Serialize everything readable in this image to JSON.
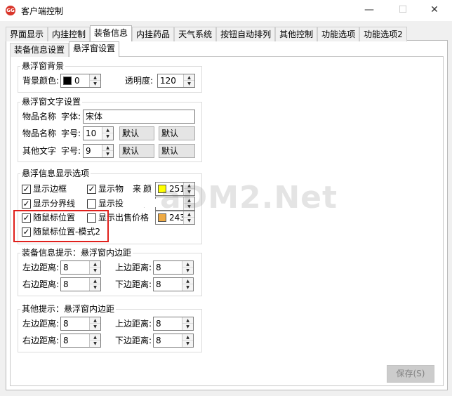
{
  "window": {
    "icon_text": "GG",
    "title": "客户端控制",
    "minimize": "—",
    "maximize": "☐",
    "close": "✕"
  },
  "tabs": [
    "界面显示",
    "内挂控制",
    "装备信息",
    "内挂药品",
    "天气系统",
    "按钮自动排列",
    "其他控制",
    "功能选项",
    "功能选项2"
  ],
  "subtabs": [
    "装备信息设置",
    "悬浮窗设置"
  ],
  "background_group": {
    "title": "悬浮窗背景",
    "color_label": "背景颜色:",
    "color_value": "0",
    "swatch_color": "#000000",
    "opacity_label": "透明度:",
    "opacity_value": "120"
  },
  "text_group": {
    "title": "悬浮窗文字设置",
    "row1_label": "物品名称",
    "font_label": "字体:",
    "font_value": "宋体",
    "row2_label": "物品名称",
    "size_label": "字号:",
    "row2_size": "10",
    "row2_combo1": "默认",
    "row2_combo2": "默认",
    "row3_label": "其他文字",
    "row3_size_label": "字号:",
    "row3_size": "9",
    "row3_combo1": "默认",
    "row3_combo2": "默认"
  },
  "display_group": {
    "title": "悬浮信息显示选项",
    "show_border": "显示边框",
    "show_item": "显示物",
    "show_item_tail": "来",
    "show_item_tail2": "颜",
    "item_color_value": "251",
    "item_color": "#ffff00",
    "show_divider": "显示分界线",
    "show_drop": "显示投",
    "show_drop_tail": "隐",
    "follow_mouse": "随鼠标位置",
    "show_price": "显示出售价格",
    "price_color_value": "243",
    "price_color": "#eeaa44",
    "follow_mouse_mode2": "随鼠标位置-模式2",
    "check_mark": "✓"
  },
  "equip_margin_group": {
    "title": "装备信息提示：悬浮窗内边距",
    "left_label": "左边距离:",
    "left_value": "8",
    "top_label": "上边距离:",
    "top_value": "8",
    "right_label": "右边距离:",
    "right_value": "8",
    "bottom_label": "下边距离:",
    "bottom_value": "8"
  },
  "other_margin_group": {
    "title": "其他提示：悬浮窗内边距",
    "left_label": "左边距离:",
    "left_value": "8",
    "top_label": "上边距离:",
    "top_value": "8",
    "right_label": "右边距离:",
    "right_value": "8",
    "bottom_label": "下边距离:",
    "bottom_value": "8"
  },
  "watermark": "aDM2.Net",
  "save_button": "保存(S)",
  "spin_up": "▲",
  "spin_down": "▼",
  "combo_chevron": "⌄"
}
